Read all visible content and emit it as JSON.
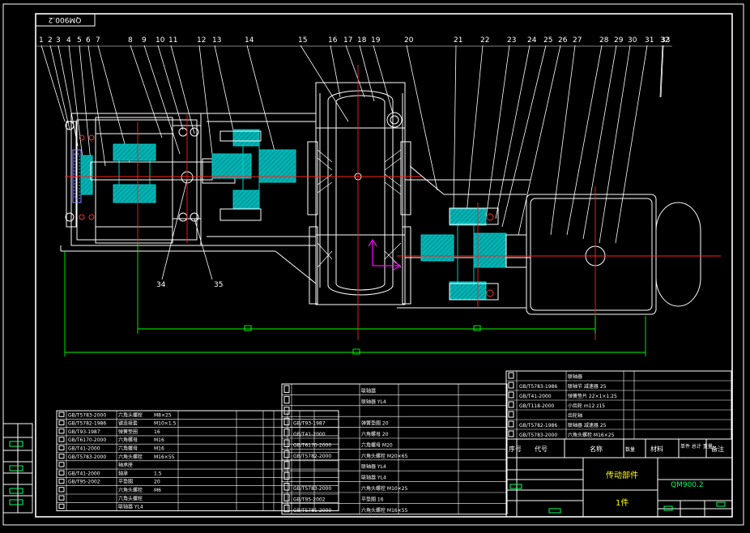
{
  "drawing": {
    "code": "QM900.2",
    "code_mirrored": "QM900.2",
    "title": "传动部件",
    "sheet_note": "1件",
    "colors": {
      "background": "#000000",
      "outline": "#ffffff",
      "section_hatch": "#00cccc",
      "centerline": "#ff2020",
      "dimension": "#00ff00",
      "leader": "#ffffff",
      "cover_plate": "#8a8aff",
      "axis_marker": "#ff00ff"
    },
    "balloons": [
      "1",
      "2",
      "3",
      "4",
      "5",
      "6",
      "7",
      "8",
      "9",
      "10",
      "11",
      "12",
      "13",
      "14",
      "15",
      "16",
      "17",
      "18",
      "19",
      "20",
      "21",
      "22",
      "23",
      "24",
      "25",
      "26",
      "27",
      "28",
      "29",
      "30",
      "31",
      "32",
      "33"
    ],
    "extra_balloons": [
      "34",
      "35"
    ],
    "title_block": {
      "header": {
        "seq": "序号",
        "code": "代号",
        "name": "名称",
        "qty": "数量",
        "material": "材料",
        "weight": "单件 总计 重量",
        "remark": "备注"
      },
      "upper_rows": [
        {
          "code": "",
          "name": "联轴器"
        },
        {
          "code": "GB/T5783-1986",
          "name": "联轴节 减速器 25"
        },
        {
          "code": "GB/T41-2000",
          "name": "弹簧垫片 22×1×1.25"
        },
        {
          "code": "GB/T118-2000",
          "name": "小齿轮 m12 z15"
        },
        {
          "code": "",
          "name": "齿轮轴"
        },
        {
          "code": "GB/T5782-1986",
          "name": "联轴器 减速器 25"
        },
        {
          "code": "GB/T5783-2000",
          "name": "六角头螺栓 M16×25"
        }
      ]
    },
    "parts_left": [
      {
        "code": "GB/T5783-2000",
        "name": "六角头螺栓",
        "spec": "M8×25"
      },
      {
        "code": "GB/T5782-1986",
        "name": "键连接套",
        "spec": "M10×1.5"
      },
      {
        "code": "GB/T93-1987",
        "name": "弹簧垫圈",
        "spec": "16"
      },
      {
        "code": "GB/T6170-2000",
        "name": "六角螺母",
        "spec": "M16"
      },
      {
        "code": "GB/T41-2000",
        "name": "六角螺母",
        "spec": "M16"
      },
      {
        "code": "GB/T5783-2000",
        "name": "六角头螺栓",
        "spec": "M16×55"
      },
      {
        "code": "",
        "name": "轴承座",
        "spec": ""
      },
      {
        "code": "GB/T41-2000",
        "name": "轴承",
        "spec": "1.5"
      },
      {
        "code": "GB/T95-2002",
        "name": "平垫圈",
        "spec": "20"
      },
      {
        "code": "",
        "name": "六角头螺栓",
        "spec": "M6"
      },
      {
        "code": "",
        "name": "六角头螺栓",
        "spec": ""
      },
      {
        "code": "",
        "name": "联轴器 YL4",
        "spec": ""
      }
    ],
    "parts_mid": [
      {
        "code": "",
        "name": "联轴器"
      },
      {
        "code": "",
        "name": "联轴器 YL4"
      },
      {
        "code": "",
        "name": ""
      },
      {
        "code": "GB/T93-1987",
        "name": "弹簧垫圈 20"
      },
      {
        "code": "GB/T41-2000",
        "name": "六角螺母 20"
      },
      {
        "code": "GB/T6170-2000",
        "name": "六角螺母 M20"
      },
      {
        "code": "GB/T5782-2000",
        "name": "六角头螺栓 M20×65"
      },
      {
        "code": "",
        "name": "联轴器 YL4"
      },
      {
        "code": "",
        "name": "联轴器 YL4"
      },
      {
        "code": "GB/T5783-2000",
        "name": "六角头螺栓 M10×25"
      },
      {
        "code": "GB/T95-2002",
        "name": "平垫圈 16"
      },
      {
        "code": "GB/T5781-2000",
        "name": "六角头螺栓 M16×55"
      }
    ]
  }
}
